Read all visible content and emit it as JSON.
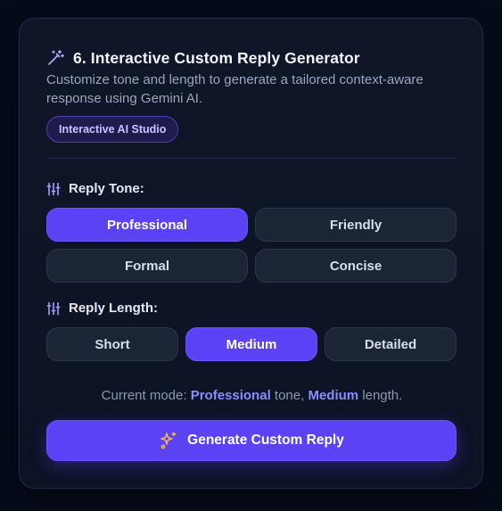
{
  "header": {
    "icon": "magic-wand-icon",
    "title": "6. Interactive Custom Reply Generator",
    "description": "Customize tone and length to generate a tailored context-aware response using Gemini AI.",
    "badge": "Interactive AI Studio"
  },
  "tone": {
    "icon": "sliders-icon",
    "label": "Reply Tone:",
    "options": [
      "Professional",
      "Friendly",
      "Formal",
      "Concise"
    ],
    "selected": "Professional"
  },
  "length": {
    "icon": "sliders-icon",
    "label": "Reply Length:",
    "options": [
      "Short",
      "Medium",
      "Detailed"
    ],
    "selected": "Medium"
  },
  "mode": {
    "prefix": "Current mode: ",
    "tone_value": "Professional",
    "middle": " tone, ",
    "length_value": "Medium",
    "suffix": " length."
  },
  "generate": {
    "icon": "sparkles-icon",
    "label": "Generate Custom Reply"
  },
  "colors": {
    "accent": "#5b43f5",
    "highlight": "#8b8dff",
    "icon_accent": "#b8a9ff",
    "sparkle": "#f5b942"
  }
}
